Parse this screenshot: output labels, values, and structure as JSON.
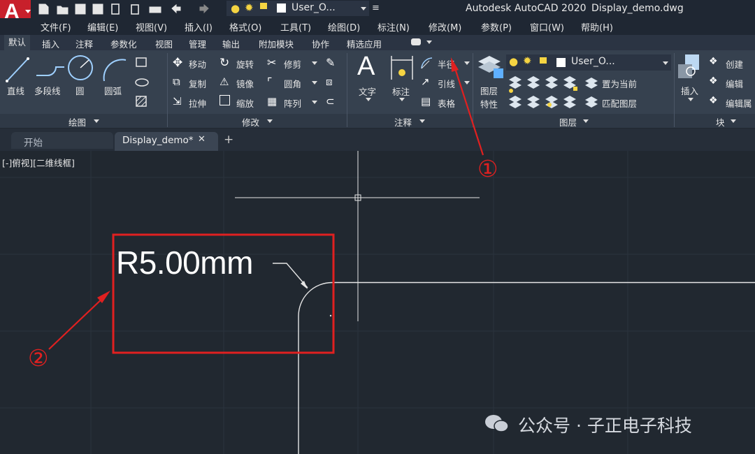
{
  "app": {
    "title": "Autodesk AutoCAD 2020",
    "filename": "Display_demo.dwg",
    "logo_letter": "A"
  },
  "qat": {
    "layer_combo_value": "User_O...",
    "icons": [
      "new-icon",
      "open-icon",
      "save-icon",
      "saveas-icon",
      "open-web-icon",
      "share-icon",
      "plot-icon",
      "undo-icon",
      "redo-icon"
    ]
  },
  "menu": {
    "items": [
      "文件(F)",
      "编辑(E)",
      "视图(V)",
      "插入(I)",
      "格式(O)",
      "工具(T)",
      "绘图(D)",
      "标注(N)",
      "修改(M)",
      "参数(P)",
      "窗口(W)",
      "帮助(H)"
    ]
  },
  "ribbon_tabs": {
    "items": [
      "默认",
      "插入",
      "注释",
      "参数化",
      "视图",
      "管理",
      "输出",
      "附加模块",
      "协作",
      "精选应用"
    ],
    "active": "默认"
  },
  "draw_panel": {
    "line": "直线",
    "polyline": "多段线",
    "circle": "圆",
    "arc": "圆弧",
    "title": "绘图"
  },
  "modify_panel": {
    "move": "移动",
    "rotate": "旋转",
    "trim": "修剪",
    "copy": "复制",
    "mirror": "镜像",
    "fillet": "圆角",
    "stretch": "拉伸",
    "scale": "缩放",
    "array": "阵列",
    "title": "修改"
  },
  "annotation_panel": {
    "text": "文字",
    "dimension": "标注",
    "radius": "半径",
    "leader": "引线",
    "table": "表格",
    "title": "注释"
  },
  "layers_panel": {
    "layer_props_1": "图层",
    "layer_props_2": "特性",
    "layer_combo": "User_O...",
    "set_current": "置为当前",
    "match_layer": "匹配图层",
    "title": "图层"
  },
  "block_panel": {
    "insert": "插入",
    "create": "创建",
    "edit": "编辑",
    "edit_attr": "编辑属",
    "title": "块"
  },
  "doc_tabs": {
    "start": "开始",
    "active": "Display_demo*",
    "close": "✕",
    "add": "+"
  },
  "viewport": {
    "label": "[-]俯视][二维线框]"
  },
  "drawing": {
    "dimension_text": "R5.00mm"
  },
  "annotations": {
    "marker_1": "①",
    "marker_2": "②",
    "accent_color": "#e02020"
  },
  "watermark": {
    "text": "公众号 · 子正电子科技"
  }
}
